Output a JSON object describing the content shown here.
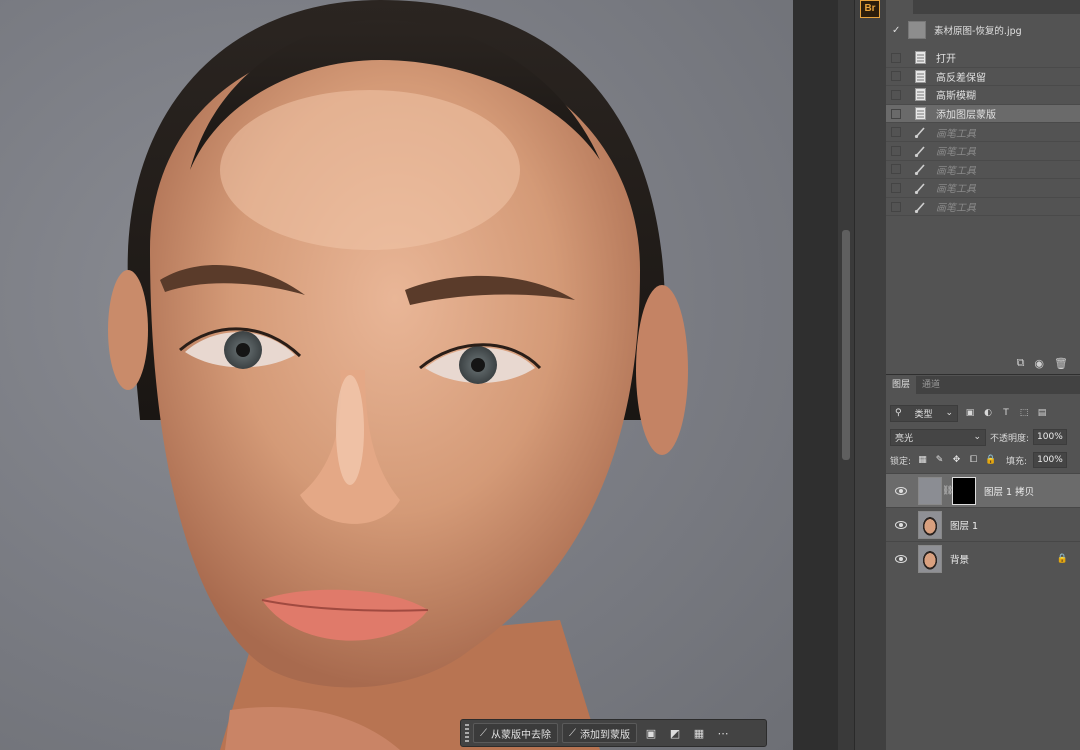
{
  "history": {
    "snapshot_name": "素材原图-恢复的.jpg",
    "items": [
      {
        "label": "打开",
        "state": "normal",
        "icon": "document-icon"
      },
      {
        "label": "高反差保留",
        "state": "normal",
        "icon": "document-icon"
      },
      {
        "label": "高斯模糊",
        "state": "normal",
        "icon": "document-icon"
      },
      {
        "label": "添加图层蒙版",
        "state": "selected",
        "icon": "document-icon"
      },
      {
        "label": "画笔工具",
        "state": "dim",
        "icon": "brush-icon"
      },
      {
        "label": "画笔工具",
        "state": "dim",
        "icon": "brush-icon"
      },
      {
        "label": "画笔工具",
        "state": "dim",
        "icon": "brush-icon"
      },
      {
        "label": "画笔工具",
        "state": "dim",
        "icon": "brush-icon"
      },
      {
        "label": "画笔工具",
        "state": "dim",
        "icon": "brush-icon"
      }
    ]
  },
  "layers_panel": {
    "tabs": [
      "图层",
      "通道"
    ],
    "filter_kind": "类型",
    "blend_mode": "亮光",
    "opacity_label": "不透明度:",
    "opacity_value": "100%",
    "lock_label": "锁定:",
    "fill_label": "填充:",
    "fill_value": "100%",
    "layers": [
      {
        "name": "图层 1 拷贝",
        "thumb": "gray",
        "has_mask": true,
        "selected": true,
        "locked": false
      },
      {
        "name": "图层 1",
        "thumb": "face",
        "has_mask": false,
        "selected": false,
        "locked": false
      },
      {
        "name": "背景",
        "thumb": "face",
        "has_mask": false,
        "selected": false,
        "locked": true
      }
    ]
  },
  "taskbar": {
    "remove_from_mask": "从蒙版中去除",
    "add_to_mask": "添加到蒙版"
  },
  "colors": {
    "panel_bg": "#535353",
    "selected_row": "#6a6a6a",
    "bridge_accent": "#e6a23c"
  }
}
